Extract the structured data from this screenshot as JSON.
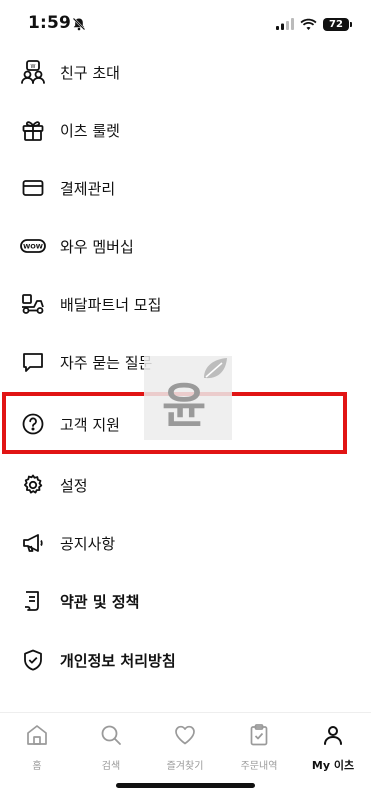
{
  "status_bar": {
    "time": "1:59",
    "battery": "72"
  },
  "menu": {
    "items": [
      {
        "label": "친구 초대",
        "icon": "friend-invite-icon"
      },
      {
        "label": "이츠 룰렛",
        "icon": "gift-icon"
      },
      {
        "label": "결제관리",
        "icon": "card-icon"
      },
      {
        "label": "와우 멤버십",
        "icon": "wow-badge-icon"
      },
      {
        "label": "배달파트너 모집",
        "icon": "delivery-scooter-icon"
      },
      {
        "label": "자주 묻는 질문",
        "icon": "chat-bubble-icon"
      },
      {
        "label": "고객 지원",
        "icon": "help-circle-icon"
      },
      {
        "label": "설정",
        "icon": "gear-icon"
      },
      {
        "label": "공지사항",
        "icon": "megaphone-icon"
      },
      {
        "label": "약관 및 정책",
        "icon": "document-icon"
      },
      {
        "label": "개인정보 처리방침",
        "icon": "shield-check-icon"
      }
    ]
  },
  "watermark": {
    "text": "윤"
  },
  "tab_bar": {
    "tabs": [
      {
        "label": "홈",
        "icon": "home-icon"
      },
      {
        "label": "검색",
        "icon": "search-icon"
      },
      {
        "label": "즐겨찾기",
        "icon": "heart-icon"
      },
      {
        "label": "주문내역",
        "icon": "clipboard-check-icon"
      },
      {
        "label": "My 이츠",
        "icon": "person-icon"
      }
    ]
  },
  "colors": {
    "highlight": "#e11414",
    "tab_inactive": "#9a9a9a",
    "text": "#111111"
  }
}
